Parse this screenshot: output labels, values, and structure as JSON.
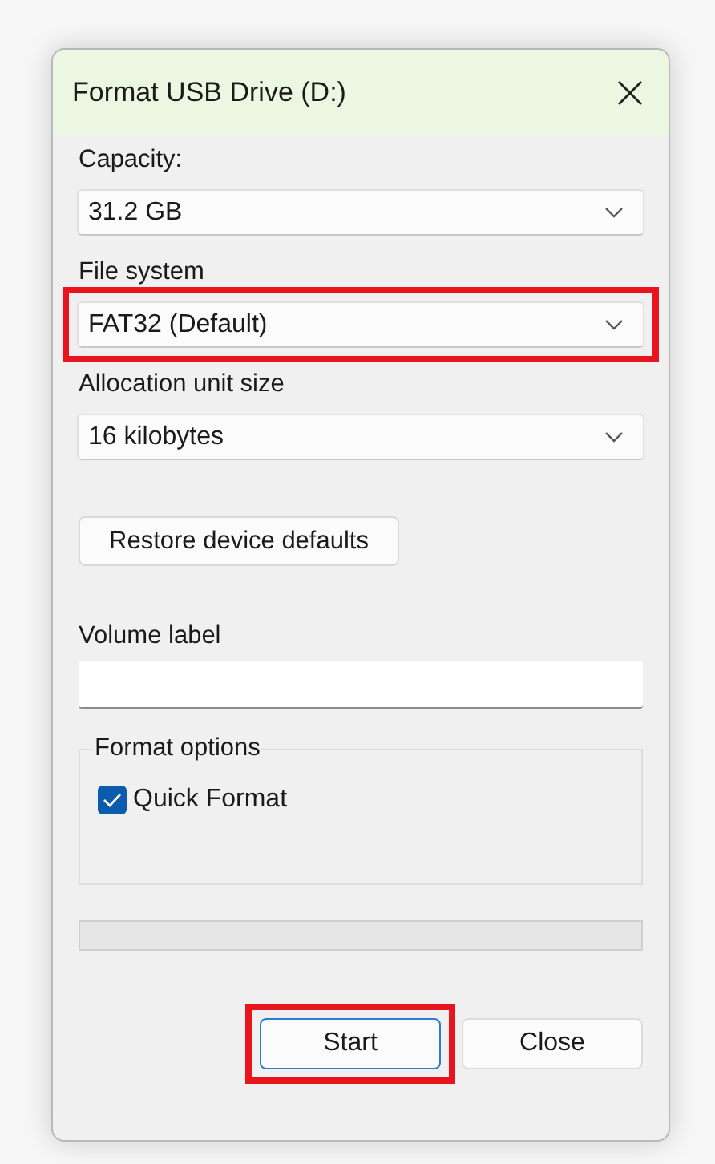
{
  "window": {
    "title": "Format USB Drive (D:)"
  },
  "fields": [
    {
      "kind": "dropdown",
      "label": "Capacity:",
      "value": "31.2 GB",
      "highlighted": false
    },
    {
      "kind": "dropdown",
      "label": "File system",
      "value": "FAT32 (Default)",
      "highlighted": true
    },
    {
      "kind": "dropdown",
      "label": "Allocation unit size",
      "value": "16 kilobytes",
      "highlighted": false
    },
    {
      "kind": "button",
      "label": "Restore device defaults"
    },
    {
      "kind": "textbox",
      "label": "Volume label"
    }
  ],
  "format_options": {
    "title": "Format options",
    "options": [
      {
        "label": "Quick Format",
        "checked": true
      }
    ]
  },
  "progress": {
    "level": 0
  },
  "buttons": [
    {
      "label": "Start",
      "highlighted": true,
      "default": true
    },
    {
      "label": "Close",
      "highlighted": false,
      "default": false
    }
  ]
}
